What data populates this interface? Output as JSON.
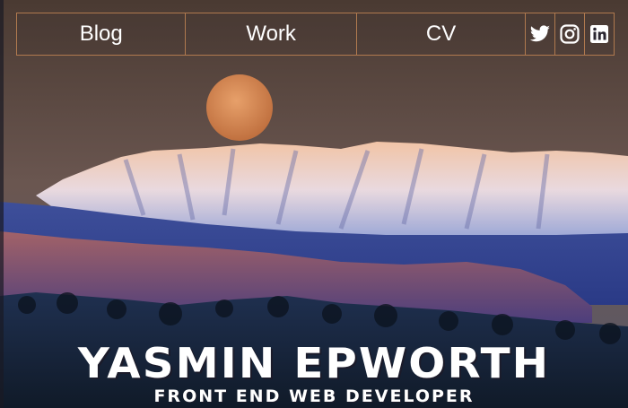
{
  "nav": {
    "items": [
      {
        "label": "Blog"
      },
      {
        "label": "Work"
      },
      {
        "label": "CV"
      }
    ],
    "social": [
      {
        "icon": "twitter-icon"
      },
      {
        "icon": "instagram-icon"
      },
      {
        "icon": "linkedin-icon"
      }
    ]
  },
  "hero": {
    "name": "YASMIN EPWORTH",
    "role": "FRONT END WEB DEVELOPER"
  },
  "colors": {
    "nav_border": "#b07a4f",
    "moon": "#d98a55",
    "text": "#ffffff"
  }
}
